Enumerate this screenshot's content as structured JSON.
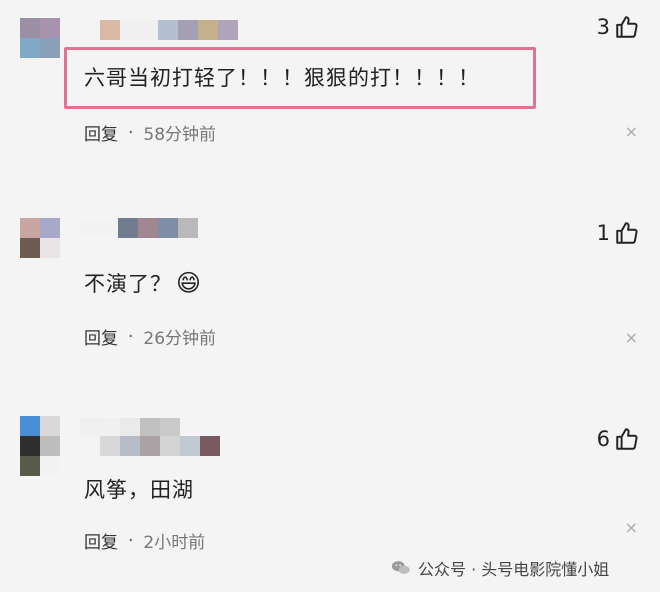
{
  "comments": [
    {
      "text": "六哥当初打轻了！！！狠狠的打！！！！",
      "likes": "3",
      "reply_label": "回复",
      "time": "58分钟前",
      "close": "×"
    },
    {
      "text": "不演了？",
      "emoji": "😄",
      "likes": "1",
      "reply_label": "回复",
      "time": "26分钟前",
      "close": "×"
    },
    {
      "text": "风筝，田湖",
      "likes": "6",
      "reply_label": "回复",
      "time": "2小时前",
      "close": "×"
    }
  ],
  "watermark": {
    "text": "公众号 · 头号电影院懂小姐"
  },
  "colors": {
    "highlight": "#e0738f",
    "background": "#f4f4f4"
  },
  "icons": {
    "like": "thumbs-up-icon",
    "close": "close-icon",
    "wechat": "wechat-icon"
  }
}
